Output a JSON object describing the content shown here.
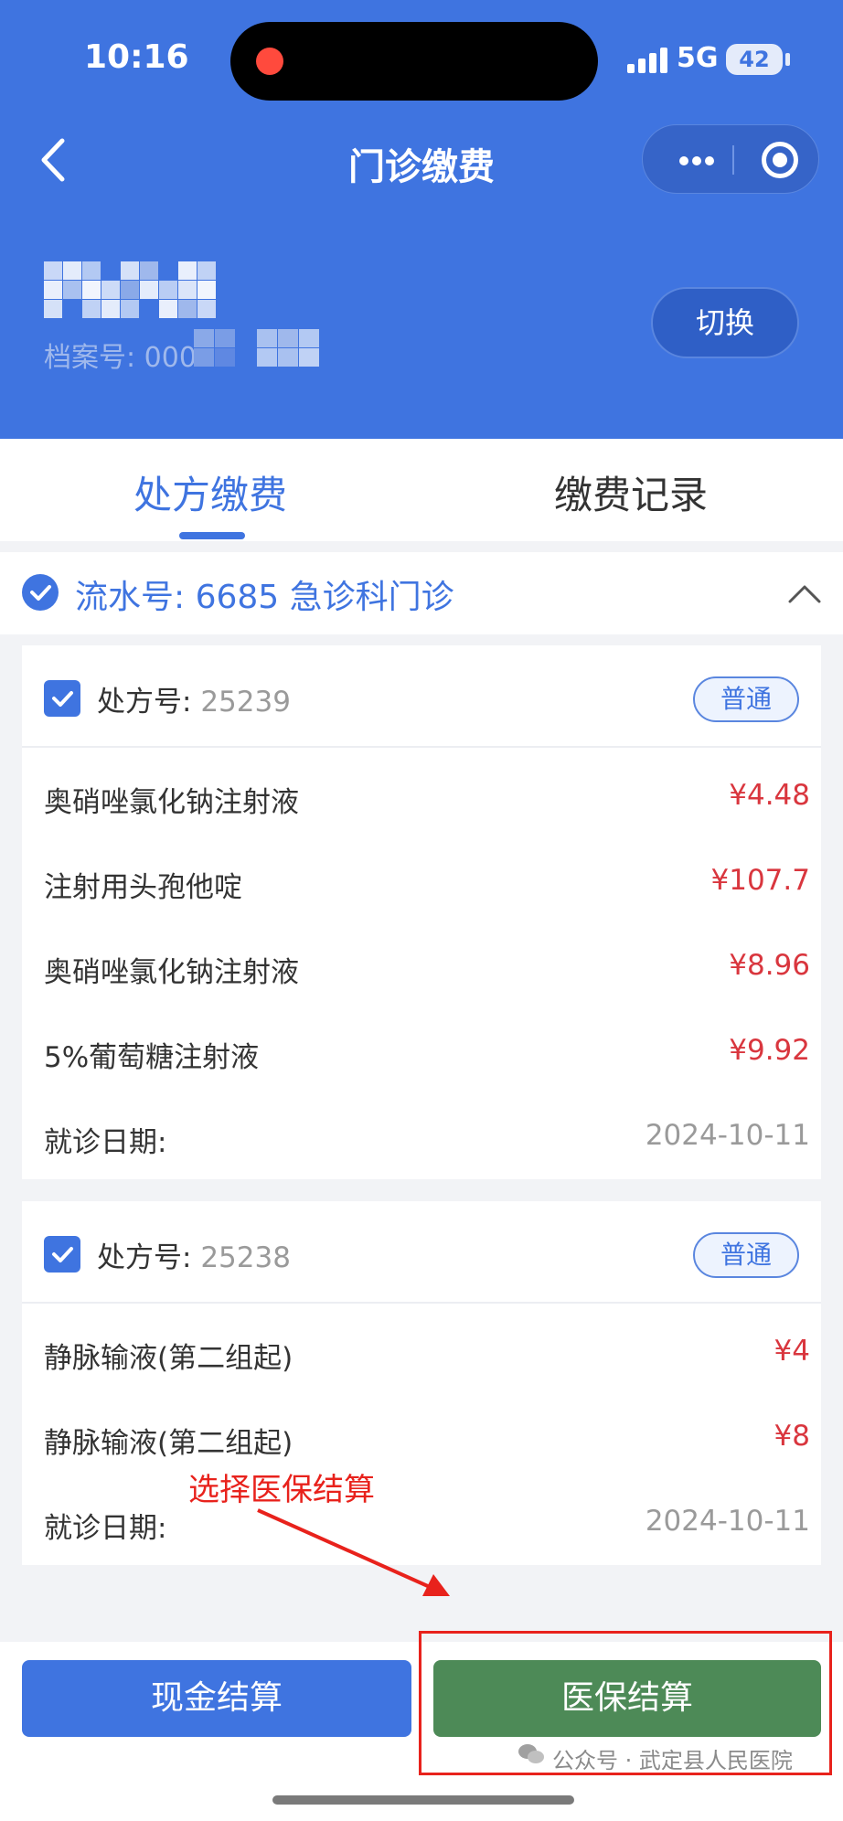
{
  "status_bar": {
    "time": "10:16",
    "network": "5G",
    "battery": "42"
  },
  "nav": {
    "title": "门诊缴费"
  },
  "patient": {
    "archive_label": "档案号: 000",
    "switch_label": "切换"
  },
  "tabs": [
    {
      "label": "处方缴费",
      "active": true
    },
    {
      "label": "缴费记录",
      "active": false
    }
  ],
  "serial": {
    "label": "流水号: 6685 急诊科门诊"
  },
  "prescriptions": [
    {
      "rx_label": "处方号:",
      "rx_number": "25239",
      "tag": "普通",
      "items": [
        {
          "name": "奥硝唑氯化钠注射液",
          "price": "¥4.48"
        },
        {
          "name": "注射用头孢他啶",
          "price": "¥107.7"
        },
        {
          "name": "奥硝唑氯化钠注射液",
          "price": "¥8.96"
        },
        {
          "name": "5%葡萄糖注射液",
          "price": "¥9.92"
        }
      ],
      "date_label": "就诊日期:",
      "date": "2024-10-11"
    },
    {
      "rx_label": "处方号:",
      "rx_number": "25238",
      "tag": "普通",
      "items": [
        {
          "name": "静脉输液(第二组起)",
          "price": "¥4"
        },
        {
          "name": "静脉输液(第二组起)",
          "price": "¥8"
        }
      ],
      "date_label": "就诊日期:",
      "date": "2024-10-11"
    }
  ],
  "annotation": {
    "text": "选择医保结算"
  },
  "buttons": {
    "cash": "现金结算",
    "insurance": "医保结算"
  },
  "watermark": {
    "text": "公众号 · 武定县人民医院"
  },
  "colors": {
    "primary": "#3f74e0",
    "insurance": "#4d8a57",
    "price": "#d9363e",
    "annotation": "#e8221c"
  }
}
